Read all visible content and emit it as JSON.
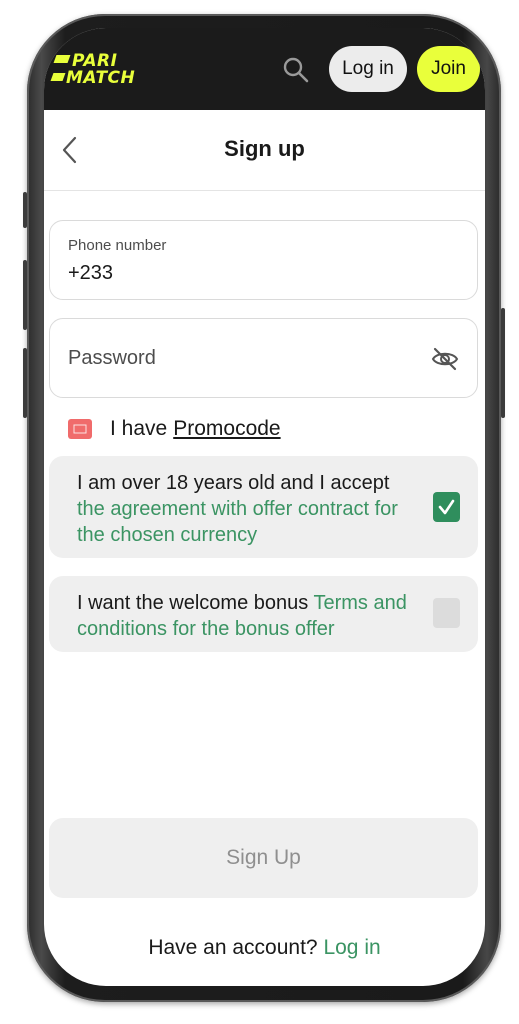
{
  "topbar": {
    "logo_line1": "PARI",
    "logo_line2": "MATCH",
    "login_label": "Log in",
    "join_label": "Join"
  },
  "header": {
    "title": "Sign up"
  },
  "form": {
    "phone": {
      "label": "Phone number",
      "value": "+233"
    },
    "password": {
      "placeholder": "Password"
    },
    "promo": {
      "prefix": "I have",
      "link": "Promocode"
    },
    "agreement": {
      "text": "I am over 18 years old and I accept",
      "link": "the agreement with offer contract for the chosen currency",
      "checked": true
    },
    "bonus": {
      "text": "I want the welcome bonus",
      "link": "Terms and conditions for the bonus offer",
      "checked": false
    },
    "submit_label": "Sign Up"
  },
  "footer": {
    "question": "Have an account?",
    "login_link": "Log in"
  },
  "colors": {
    "brand_yellow": "#e9ff3b",
    "link_green": "#3b9463",
    "checkbox_green": "#2f8e5d",
    "topbar_bg": "#1b1b1b"
  },
  "icons": [
    "search-icon",
    "back-chevron-icon",
    "eye-off-icon",
    "ticket-icon",
    "check-icon"
  ]
}
